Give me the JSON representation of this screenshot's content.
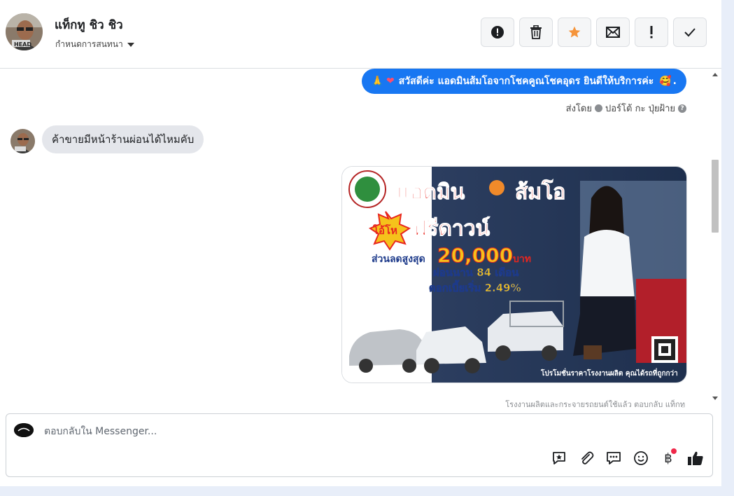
{
  "header": {
    "contact_name": "แท็กทู ชิว ชิว",
    "assign_label": "กำหนดการสนทนา",
    "avatar_caption": "HEAD",
    "actions": [
      {
        "name": "spam-alert-button",
        "icon": "alert-circle-icon"
      },
      {
        "name": "delete-button",
        "icon": "trash-icon"
      },
      {
        "name": "star-button",
        "icon": "star-icon"
      },
      {
        "name": "mark-unread-button",
        "icon": "envelope-icon"
      },
      {
        "name": "follow-up-button",
        "icon": "exclamation-icon"
      },
      {
        "name": "done-button",
        "icon": "check-icon"
      }
    ]
  },
  "messages": {
    "outgoing_greeting": "สวัสดีค่ะ แอดมินส้มโอจากโชคคูณโชคอุดร ยินดีให้บริการค่ะ",
    "sent_by_label": "ส่งโดย",
    "sent_by_name": "ปอร์โต้ กะ ปุ่ยฝ้าย",
    "incoming_question": "ค้าขายมีหน้าร้านผ่อนได้ไหมคับ",
    "truncated_caption": "โรงงานผลิตและกระจายรถยนต์ใช้แล้ว ตอบกลับ แท็กทู"
  },
  "ad": {
    "title_part1": "แอดมิน",
    "title_part2": "ส้มโอ",
    "burst_label": "โอ้โห",
    "free_down": "ฟรีดาวน์",
    "discount_label": "ส่วนลดสูงสุด",
    "discount_amount": "20,000",
    "discount_unit": "บาท",
    "installment": "ผ่อนนาน 84 เดือน",
    "interest": "ดอกเบี้ยเริ่ม 2.49%",
    "footer": "โปรโมชั่นราคาโรงงานผลิต คุณได้รถที่ถูกกว่า"
  },
  "composer": {
    "placeholder": "ตอบกลับใน Messenger...",
    "tools": [
      "saved-reply-icon",
      "attachment-icon",
      "chat-bubble-icon",
      "emoji-icon",
      "baht-payment-icon",
      "like-icon"
    ],
    "baht_symbol": "฿"
  },
  "colors": {
    "accent": "#1877f2",
    "star": "#f5943a",
    "notification": "#f02849"
  }
}
